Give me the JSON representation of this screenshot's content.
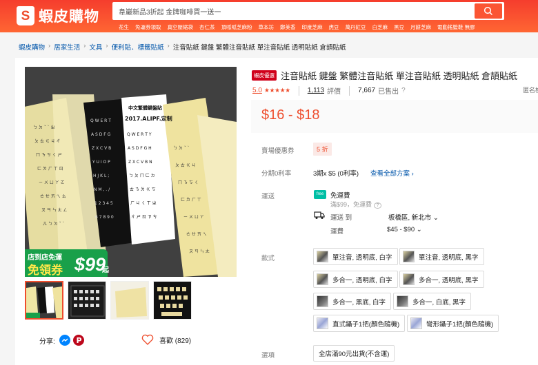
{
  "header": {
    "logo_text": "蝦皮購物",
    "search_placeholder": "韋巖新品3折起 金牌咖啡買一送一",
    "hints": [
      "花生",
      "免運券領取",
      "真空壓縮袋",
      "杏仁茶",
      "頂呱呱芝麻粉",
      "草本坊",
      "鄭美香",
      "印度芝麻",
      "虎豆",
      "萬丹紅豆",
      "白芝麻",
      "黑豆",
      "月餅芝麻",
      "電動搖籃鞋 無膠"
    ]
  },
  "breadcrumb": [
    "蝦皮購物",
    "居家生活",
    "文具",
    "便利貼．標籤貼紙",
    "注音貼紙 鍵盤 繁體注音貼紙 單注音貼紙 透明貼紙 倉頡貼紙"
  ],
  "gallery": {
    "promo_line1": "店到店免運",
    "promo_line2": "免領券",
    "promo_amount": "$99",
    "promo_suffix": "起",
    "image_text": [
      "中文繁體鍵盤貼",
      "2017.ALIPF.定制"
    ]
  },
  "share": {
    "label": "分享:",
    "like_label": "喜歡 (829)"
  },
  "product": {
    "badge": "蝦皮優選",
    "title": "注音貼紙 鍵盤 繁體注音貼紙 單注音貼紙 透明貼紙 倉頡貼紙",
    "rating": "5.0",
    "stars": "★★★★★",
    "reviews_count": "1,113",
    "reviews_label": "評價",
    "sold_count": "7,667",
    "sold_label": "已售出",
    "report": "匿名檢舉",
    "price": "$16 - $18"
  },
  "details": {
    "voucher_label": "賣場優惠券",
    "voucher_value": "5 折",
    "installment_label": "分期0利率",
    "installment_value": "3期x $5 (0利率)",
    "installment_link": "查看全部方案",
    "shipping_label": "運送",
    "free_ship": "免運費",
    "free_ship_badge": "free",
    "free_ship_sub": "滿$99，免運費",
    "ship_to_label": "運送 到",
    "ship_to_value": "板橋區, 新北市",
    "ship_fee_label": "運費",
    "ship_fee_value": "$45 - $90",
    "variation_label": "款式",
    "variations": [
      "單注音, 透明底, 白字",
      "單注音, 透明底, 黑字",
      "多合一, 透明底, 白字",
      "多合一, 透明底, 黑字",
      "多合一, 黑底, 白字",
      "多合一, 白底, 黑字",
      "直式鑷子1把(顏色隨機)",
      "彎形鑷子1把(顏色隨機)"
    ],
    "option_label": "選項",
    "option_value": "全店滿90元出貨(不含運)"
  },
  "colors": {
    "brand": "#ee4d2d",
    "link": "#0055aa",
    "free_ship": "#00bfa5"
  }
}
